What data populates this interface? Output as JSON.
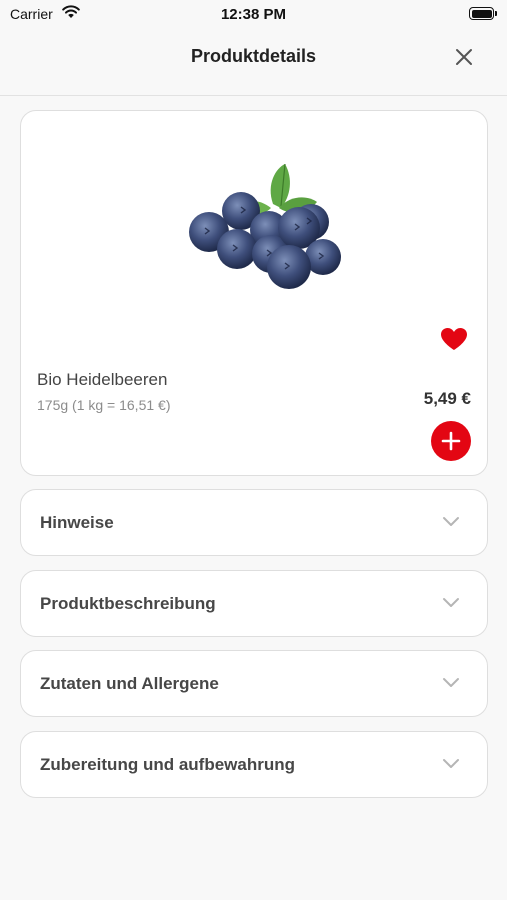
{
  "status_bar": {
    "carrier": "Carrier",
    "time": "12:38 PM"
  },
  "nav": {
    "title": "Produktdetails"
  },
  "product": {
    "name": "Bio Heidelbeeren",
    "unit_info": "175g (1 kg = 16,51 €)",
    "price": "5,49 €",
    "favorite": true,
    "image": "blueberries-image"
  },
  "sections": [
    {
      "label": "Hinweise"
    },
    {
      "label": "Produktbeschreibung"
    },
    {
      "label": "Zutaten und Allergene"
    },
    {
      "label": "Zubereitung und aufbewahrung"
    }
  ],
  "colors": {
    "accent": "#e30613",
    "background": "#f8f8f8",
    "card": "#ffffff",
    "border": "#dedede"
  }
}
